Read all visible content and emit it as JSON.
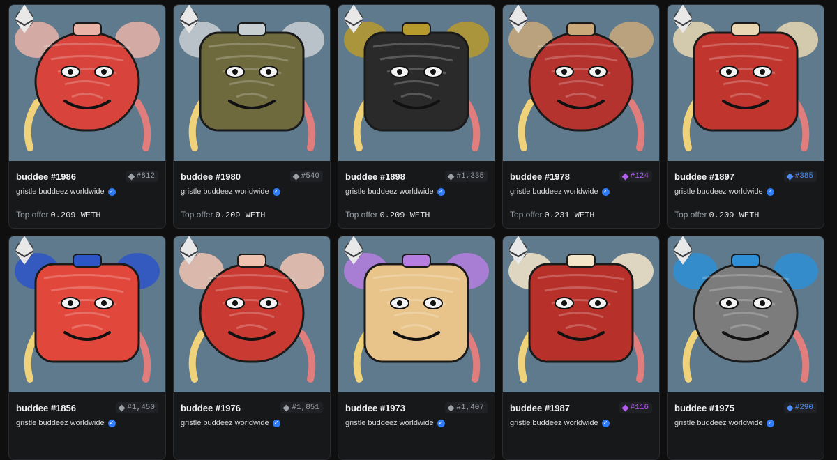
{
  "collection_name": "gristle buddeez worldwide",
  "offer_label": "Top offer",
  "currency": "WETH",
  "items": [
    {
      "name": "buddee #1986",
      "rank": "#812",
      "rank_color": "gray",
      "offer": "0.209",
      "bg": "#5f7a8c",
      "face": "#d8433b",
      "accent": "#e9b3a8"
    },
    {
      "name": "buddee #1980",
      "rank": "#540",
      "rank_color": "gray",
      "offer": "0.209",
      "bg": "#5f7a8c",
      "face": "#6f6a3e",
      "accent": "#c8cfd2"
    },
    {
      "name": "buddee #1898",
      "rank": "#1,335",
      "rank_color": "gray",
      "offer": "0.209",
      "bg": "#5f7a8c",
      "face": "#2a2a2a",
      "accent": "#b79a2e"
    },
    {
      "name": "buddee #1978",
      "rank": "#124",
      "rank_color": "purple",
      "offer": "0.231",
      "bg": "#5f7a8c",
      "face": "#b5332e",
      "accent": "#c9a97a"
    },
    {
      "name": "buddee #1897",
      "rank": "#385",
      "rank_color": "blue",
      "offer": "0.209",
      "bg": "#5f7a8c",
      "face": "#c0362f",
      "accent": "#e8d7b2"
    },
    {
      "name": "buddee #1856",
      "rank": "#1,450",
      "rank_color": "gray",
      "offer": "",
      "bg": "#5f7a8c",
      "face": "#e2473c",
      "accent": "#2e55c8"
    },
    {
      "name": "buddee #1976",
      "rank": "#1,851",
      "rank_color": "gray",
      "offer": "",
      "bg": "#5f7a8c",
      "face": "#c93a32",
      "accent": "#f0c3b0"
    },
    {
      "name": "buddee #1973",
      "rank": "#1,407",
      "rank_color": "gray",
      "offer": "",
      "bg": "#5f7a8c",
      "face": "#e9c48a",
      "accent": "#b57ee0"
    },
    {
      "name": "buddee #1987",
      "rank": "#116",
      "rank_color": "purple",
      "offer": "",
      "bg": "#5f7a8c",
      "face": "#b8302a",
      "accent": "#f5e6c9"
    },
    {
      "name": "buddee #1975",
      "rank": "#290",
      "rank_color": "blue",
      "offer": "",
      "bg": "#5f7a8c",
      "face": "#7c7c7c",
      "accent": "#2e8fd6"
    }
  ]
}
